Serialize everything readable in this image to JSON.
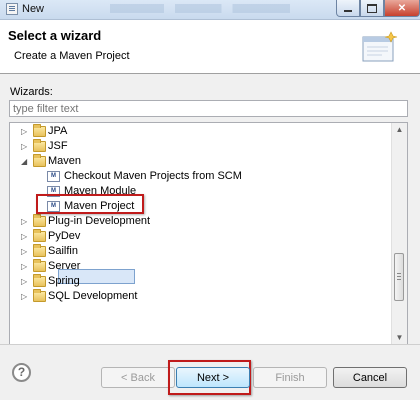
{
  "window": {
    "title": "New"
  },
  "header": {
    "title": "Select a wizard",
    "subtitle": "Create a Maven Project"
  },
  "wizards": {
    "label": "Wizards:",
    "filter_placeholder": "type filter text",
    "items": [
      {
        "label": "JPA",
        "icon": "folder-icon",
        "expanded": false,
        "level": 0
      },
      {
        "label": "JSF",
        "icon": "folder-icon",
        "expanded": false,
        "level": 0
      },
      {
        "label": "Maven",
        "icon": "folder-icon",
        "expanded": true,
        "level": 0
      },
      {
        "label": "Checkout Maven Projects from SCM",
        "icon": "maven-checkout-icon",
        "level": 1
      },
      {
        "label": "Maven Module",
        "icon": "maven-module-icon",
        "level": 1
      },
      {
        "label": "Maven Project",
        "icon": "maven-project-icon",
        "level": 1,
        "selected": true
      },
      {
        "label": "Plug-in Development",
        "icon": "folder-icon",
        "expanded": false,
        "level": 0
      },
      {
        "label": "PyDev",
        "icon": "folder-icon",
        "expanded": false,
        "level": 0
      },
      {
        "label": "Sailfin",
        "icon": "folder-icon",
        "expanded": false,
        "level": 0
      },
      {
        "label": "Server",
        "icon": "folder-icon",
        "expanded": false,
        "level": 0
      },
      {
        "label": "Spring",
        "icon": "folder-icon",
        "expanded": false,
        "level": 0
      },
      {
        "label": "SQL Development",
        "icon": "folder-icon",
        "expanded": false,
        "level": 0
      }
    ]
  },
  "footer": {
    "help_label": "?",
    "back_label": "< Back",
    "next_label": "Next >",
    "finish_label": "Finish",
    "cancel_label": "Cancel"
  },
  "colors": {
    "highlight_border": "#c01b1b",
    "selection": "#d9e7f8"
  }
}
